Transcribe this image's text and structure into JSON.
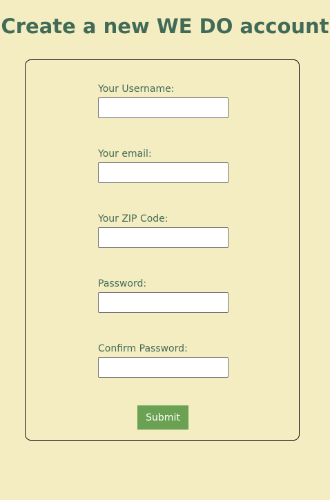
{
  "page": {
    "title": "Create a new WE DO account"
  },
  "form": {
    "fields": [
      {
        "label": "Your Username:",
        "value": "",
        "placeholder": ""
      },
      {
        "label": "Your email:",
        "value": "",
        "placeholder": ""
      },
      {
        "label": "Your ZIP Code:",
        "value": "",
        "placeholder": ""
      },
      {
        "label": "Password:",
        "value": "",
        "placeholder": ""
      },
      {
        "label": "Confirm Password:",
        "value": "",
        "placeholder": ""
      }
    ],
    "submit_label": "Submit"
  },
  "colors": {
    "background": "#f5edc2",
    "title_text": "#426b57",
    "label_text": "#426b57",
    "submit_background": "#6aa152",
    "submit_text": "#ffffff",
    "card_border": "#111111"
  }
}
